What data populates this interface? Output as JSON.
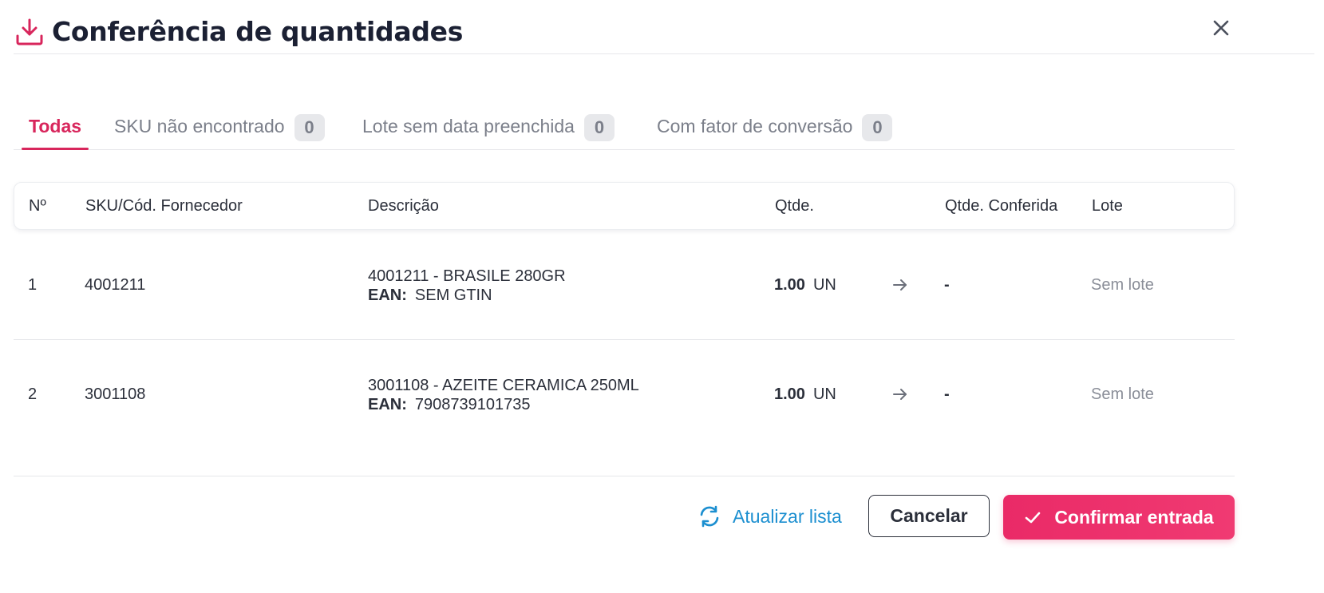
{
  "header": {
    "title": "Conferência de quantidades",
    "icon": "download-icon",
    "close_icon": "close-icon"
  },
  "tabs": [
    {
      "label": "Todas",
      "count": null,
      "active": true
    },
    {
      "label": "SKU não encontrado",
      "count": "0",
      "active": false
    },
    {
      "label": "Lote sem data preenchida",
      "count": "0",
      "active": false
    },
    {
      "label": "Com fator de conversão",
      "count": "0",
      "active": false
    }
  ],
  "table": {
    "columns": [
      "Nº",
      "SKU/Cód. Fornecedor",
      "Descrição",
      "Qtde.",
      "Qtde. Conferida",
      "Lote"
    ],
    "rows": [
      {
        "num": "1",
        "sku": "4001211",
        "description": "4001211 - BRASILE 280GR",
        "ean_label": "EAN:",
        "ean": "SEM GTIN",
        "qty": "1.00",
        "unit": "UN",
        "qty_checked": "-",
        "lote": "Sem lote"
      },
      {
        "num": "2",
        "sku": "3001108",
        "description": "3001108 - AZEITE CERAMICA 250ML",
        "ean_label": "EAN:",
        "ean": "7908739101735",
        "qty": "1.00",
        "unit": "UN",
        "qty_checked": "-",
        "lote": "Sem lote"
      }
    ]
  },
  "footer": {
    "refresh_label": "Atualizar lista",
    "cancel_label": "Cancelar",
    "confirm_label": "Confirmar entrada"
  },
  "colors": {
    "accent": "#d8265c",
    "confirm": "#ea2a67",
    "link": "#1c8fd0",
    "title": "#1b2033",
    "muted": "#7b7f8a"
  }
}
